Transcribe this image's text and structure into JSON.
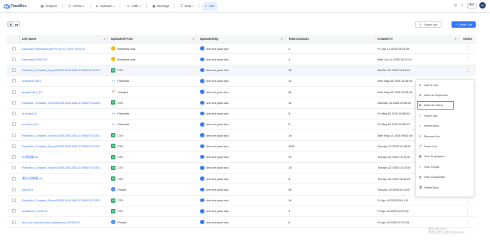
{
  "nav": {
    "brand": "FlashRev",
    "items": [
      {
        "label": "Analytics",
        "icon": "chart-icon",
        "chevron": false,
        "active": false
      },
      {
        "label": "AIFlow",
        "icon": "flow-icon",
        "chevron": true,
        "active": false
      },
      {
        "label": "Outreach",
        "icon": "send-icon",
        "chevron": true,
        "active": false
      },
      {
        "label": "Calls",
        "icon": "phone-icon",
        "chevron": true,
        "active": false
      },
      {
        "label": "Meetings",
        "icon": "calendar-icon",
        "chevron": false,
        "active": false
      },
      {
        "label": "Data",
        "icon": "database-icon",
        "chevron": true,
        "active": false
      },
      {
        "label": "Lists",
        "icon": "list-icon",
        "chevron": false,
        "active": true
      }
    ],
    "lang": "中/E",
    "avatar": "HD"
  },
  "toolbar": {
    "export_label": "Export List",
    "create_label": "Create List"
  },
  "table": {
    "columns": {
      "name": "List Name",
      "from": "Uploaded From",
      "by": "Uploaded By",
      "total": "Total Contacts",
      "at": "Created At",
      "action": "Action"
    },
    "rows": [
      {
        "name": "Unnamed BusinessCard Fri Jun 13 2025 15:20:37",
        "from": "Business card",
        "src": "card",
        "by": "she one yuan two",
        "total": "2",
        "at": "Fri Jun 13 2025 15:20:38"
      },
      {
        "name": "Unnamed20250723",
        "from": "Business card",
        "src": "card",
        "by": "she one yuan two",
        "total": "1",
        "at": "Wed Jun 11 2025 15:22:43"
      },
      {
        "name": "Flashinfo_Contacts_Export20250110111832-1736507912153...",
        "from": "CSV",
        "src": "csv",
        "by": "she one yuan two",
        "total": "10",
        "at": "Sat Jun 07 2025 05:14:44"
      },
      {
        "name": "outbound 0523",
        "from": "Flashinfo",
        "src": "flash",
        "by": "she one yuan two",
        "total": "14",
        "at": "Wed May 28 2025 02:46:00"
      },
      {
        "name": "people list 5_13",
        "from": "Hubspot",
        "src": "hub",
        "by": "she one yuan two",
        "total": "34",
        "at": "Wed May 28 2025 02:36:45"
      },
      {
        "name": "Flashinfo_Contacts_Export20250110111832-1736507912153...",
        "from": "CSV",
        "src": "csv",
        "by": "she one yuan two",
        "total": "10",
        "at": "Sat May 24 2025 09:08:42"
      },
      {
        "name": "in bound 01",
        "from": "Flashinfo",
        "src": "flash",
        "by": "she one yuan two",
        "total": "5",
        "at": "Fri May 16 2025 09:58:45"
      },
      {
        "name": "out bound 01",
        "from": "Flashinfo",
        "src": "flash",
        "by": "she one yuan two",
        "total": "5",
        "at": "Fri May 16 2025 09:55:03"
      },
      {
        "name": "Flashinfo_Contacts_Export20250110111832-1736507912153...",
        "from": "CSV",
        "src": "csv",
        "by": "she one yuan two",
        "total": "10",
        "at": "Wed May 14 2025 09:52:26"
      },
      {
        "name": "Flashinfo_Contacts_Export20250110111832-1736507912153...",
        "from": "CSV",
        "src": "csv",
        "by": "she one yuan two",
        "total": "4987",
        "at": "Sun Apr 27 2025 10:28:29"
      },
      {
        "name": "20条数据.csv",
        "from": "CSV",
        "src": "csv",
        "by": "she one yuan two",
        "total": "20",
        "at": "Tue Apr 22 2025 15:14:32"
      },
      {
        "name": "Flashinfo_Contacts_Export20250110111832-1736507912153...",
        "from": "CSV",
        "src": "csv",
        "by": "she one yuan two",
        "total": "10",
        "at": "Tue Apr 22 2025 15:13:00"
      },
      {
        "name": "最后5条数据.csv",
        "from": "CSV",
        "src": "csv",
        "by": "she one yuan two",
        "total": "5",
        "at": "Tue Apr 22 2025 08:32:26"
      },
      {
        "name": "yuan323",
        "from": "People",
        "src": "people",
        "by": "she one yuan two",
        "total": "30",
        "at": "Sun Apr 20 2025 04:24:07"
      },
      {
        "name": "Flashinfo_Contacts_Export20250110111832-1736507912153...",
        "from": "CSV",
        "src": "csv",
        "by": "she one yuan two",
        "total": "10",
        "at": "Fri Apr 18 2025 10:41:11"
      },
      {
        "name": "undefined_1205.csv",
        "from": "CSV",
        "src": "csv",
        "by": "she one yuan two",
        "total": "1",
        "at": "Fri Apr 18 2025 10:23:01"
      },
      {
        "name": "test_csv_upload_view_employees_20250416",
        "from": "People",
        "src": "people",
        "by": "she one yuan two",
        "total": "6",
        "at": "Fri Apr 18 2025 07:03:03"
      }
    ]
  },
  "menu": {
    "items": [
      {
        "label": "Add To List",
        "icon": "plus-icon"
      },
      {
        "label": "Add Into Sequence",
        "icon": "sequence-icon"
      },
      {
        "label": "Add Into Vision",
        "icon": "vision-icon",
        "highlight": true
      },
      {
        "label": "Export List",
        "icon": "export-icon"
      },
      {
        "label": "Import More",
        "icon": "import-icon"
      },
      {
        "label": "Rename List",
        "icon": "edit-icon"
      },
      {
        "label": "Share List",
        "icon": "share-icon"
      },
      {
        "label": "View Employees",
        "icon": "employees-icon"
      },
      {
        "label": "View People",
        "icon": "people-icon"
      },
      {
        "label": "View Companies",
        "icon": "companies-icon"
      },
      {
        "label": "Delete Row",
        "icon": "delete-icon"
      }
    ]
  },
  "watermark": {
    "line1": "激活 Windows",
    "line2": "转到\"设置\"以激活 Windows。"
  }
}
